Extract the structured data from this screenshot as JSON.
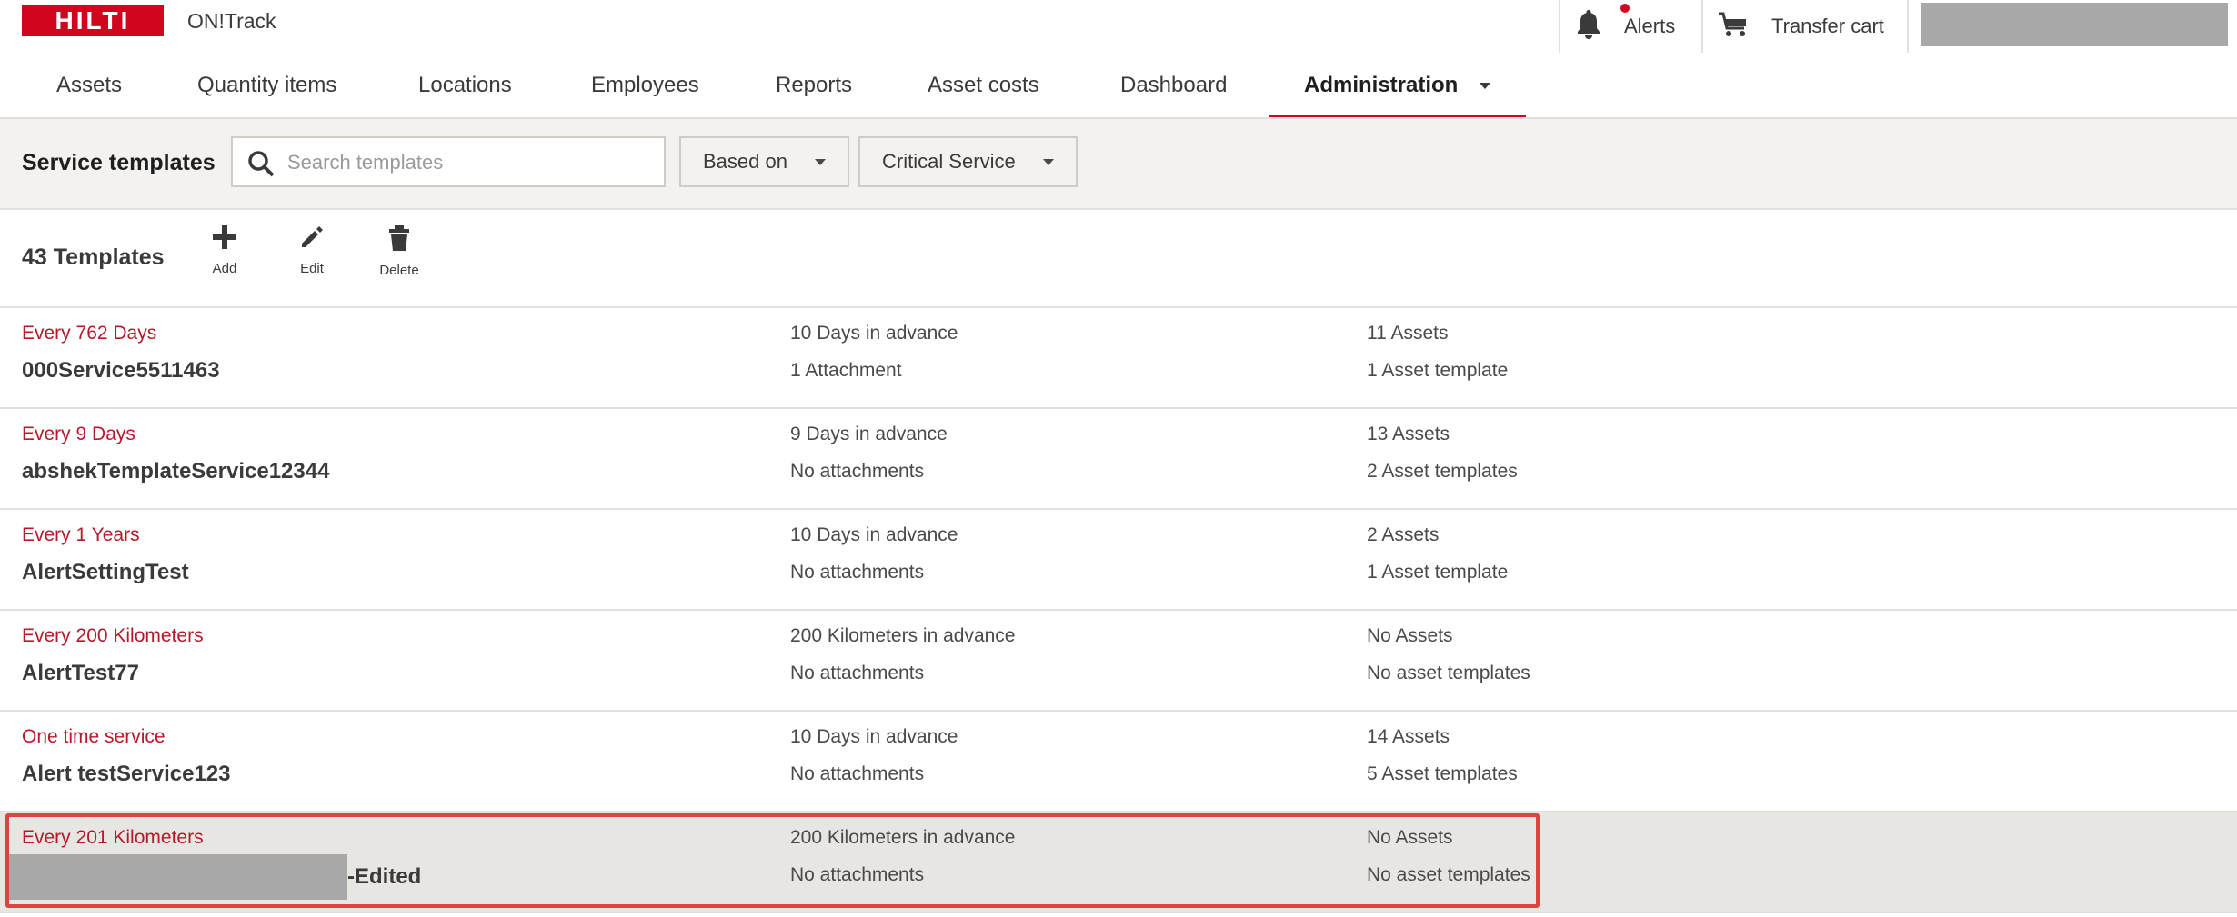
{
  "header": {
    "logo_text": "HILTI",
    "app_name": "ON!Track",
    "alerts_label": "Alerts",
    "transfer_cart_label": "Transfer cart"
  },
  "nav": {
    "items": [
      "Assets",
      "Quantity items",
      "Locations",
      "Employees",
      "Reports",
      "Asset costs",
      "Dashboard",
      "Administration"
    ],
    "active": "Administration"
  },
  "filterbar": {
    "title": "Service templates",
    "search_placeholder": "Search templates",
    "based_on_label": "Based on",
    "critical_label": "Critical Service"
  },
  "toolbar": {
    "count": "43 Templates",
    "add_label": "Add",
    "edit_label": "Edit",
    "delete_label": "Delete"
  },
  "rows": [
    {
      "interval": "Every 762 Days",
      "name": "000Service5511463",
      "advance": "10 Days in advance",
      "attachments": "1 Attachment",
      "assets": "11 Assets",
      "asset_templates": "1 Asset template"
    },
    {
      "interval": "Every 9 Days",
      "name": "abshekTemplateService12344",
      "advance": "9 Days in advance",
      "attachments": "No attachments",
      "assets": "13 Assets",
      "asset_templates": "2 Asset templates"
    },
    {
      "interval": "Every 1 Years",
      "name": "AlertSettingTest",
      "advance": "10 Days in advance",
      "attachments": "No attachments",
      "assets": "2 Assets",
      "asset_templates": "1 Asset template"
    },
    {
      "interval": "Every 200 Kilometers",
      "name": "AlertTest77",
      "advance": "200 Kilometers in advance",
      "attachments": "No attachments",
      "assets": "No Assets",
      "asset_templates": "No asset templates"
    },
    {
      "interval": "One time service",
      "name": "Alert testService123",
      "advance": "10 Days in advance",
      "attachments": "No attachments",
      "assets": "14 Assets",
      "asset_templates": "5 Asset templates"
    },
    {
      "interval": "Every 201 Kilometers",
      "name": "-Edited",
      "advance": "200 Kilometers in advance",
      "attachments": "No attachments",
      "assets": "No Assets",
      "asset_templates": "No asset templates",
      "selected": true
    }
  ],
  "colors": {
    "brand_red": "#d2051e",
    "interval_red": "#b5192b",
    "highlight_border": "#e0433f"
  }
}
